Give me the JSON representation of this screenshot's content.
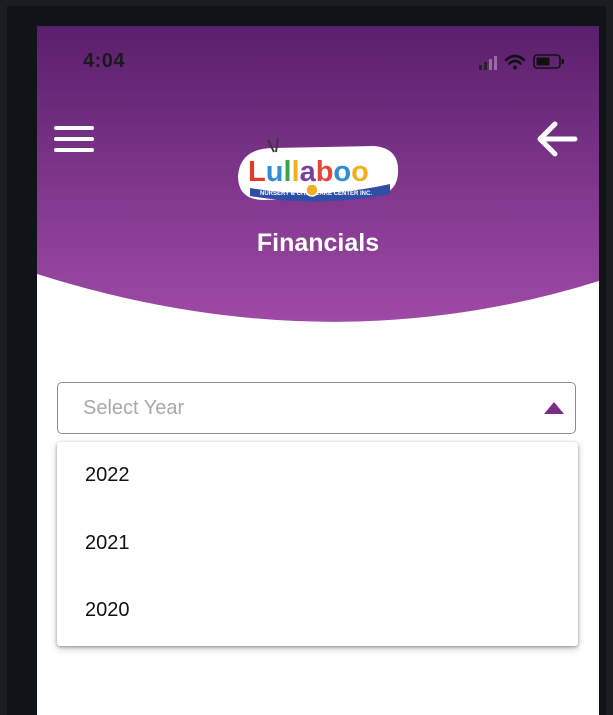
{
  "status_bar": {
    "time": "4:04"
  },
  "header": {
    "title": "Financials",
    "logo_text": "Lullaboo",
    "logo_subtitle": "NURSERY & CHILDCARE CENTER INC.",
    "menu_icon": "hamburger-menu-icon",
    "back_icon": "arrow-left-icon"
  },
  "year_select": {
    "placeholder": "Select Year",
    "options": [
      "2022",
      "2021",
      "2020"
    ]
  },
  "colors": {
    "header_top": "#5a1f6c",
    "header_bottom": "#9e4aa6",
    "accent": "#7a2d86"
  }
}
